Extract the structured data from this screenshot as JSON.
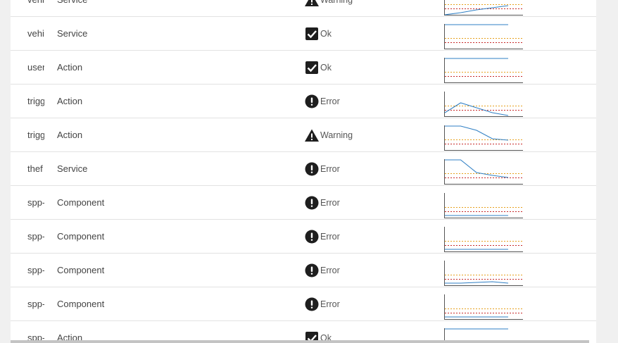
{
  "colors": {
    "spark_line": "#2f7fc4",
    "threshold_warning": "#e6a01c",
    "threshold_error": "#c62828",
    "axis": "#555555",
    "status_icon": "#1e1e1e"
  },
  "table": {
    "rows": [
      {
        "name": "vehi",
        "type": "Service",
        "status": "Warning",
        "icon": "warning-triangle-icon",
        "spark": [
          34,
          31,
          27,
          24,
          21
        ]
      },
      {
        "name": "vehi",
        "type": "Service",
        "status": "Ok",
        "icon": "checkbox-checked-icon",
        "spark": [
          0,
          0,
          0,
          0,
          0
        ]
      },
      {
        "name": "user",
        "type": "Action",
        "status": "Ok",
        "icon": "checkbox-checked-icon",
        "spark": [
          0,
          0,
          0,
          0,
          0
        ]
      },
      {
        "name": "trigg",
        "type": "Action",
        "status": "Error",
        "icon": "exclamation-circle-icon",
        "spark": [
          29,
          15,
          22,
          29,
          33
        ]
      },
      {
        "name": "trigg",
        "type": "Action",
        "status": "Warning",
        "icon": "warning-triangle-icon",
        "spark": [
          0,
          0,
          6,
          18,
          20
        ]
      },
      {
        "name": "thef",
        "type": "Service",
        "status": "Error",
        "icon": "exclamation-circle-icon",
        "spark": [
          0,
          0,
          18,
          22,
          25
        ]
      },
      {
        "name": "spp-",
        "type": "Component",
        "status": "Error",
        "icon": "exclamation-circle-icon",
        "spark": [
          31,
          31,
          31,
          31,
          31
        ]
      },
      {
        "name": "spp-",
        "type": "Component",
        "status": "Error",
        "icon": "exclamation-circle-icon",
        "spark": [
          31,
          31,
          31,
          31,
          31
        ]
      },
      {
        "name": "spp-",
        "type": "Component",
        "status": "Error",
        "icon": "exclamation-circle-icon",
        "spark": [
          31,
          31,
          30,
          29,
          31
        ]
      },
      {
        "name": "spp-",
        "type": "Component",
        "status": "Error",
        "icon": "exclamation-circle-icon",
        "spark": [
          31,
          31,
          31,
          31,
          31
        ]
      },
      {
        "name": "spp-",
        "type": "Action",
        "status": "Ok",
        "icon": "checkbox-checked-icon",
        "spark": [
          0,
          0,
          0,
          0,
          0
        ]
      }
    ]
  }
}
